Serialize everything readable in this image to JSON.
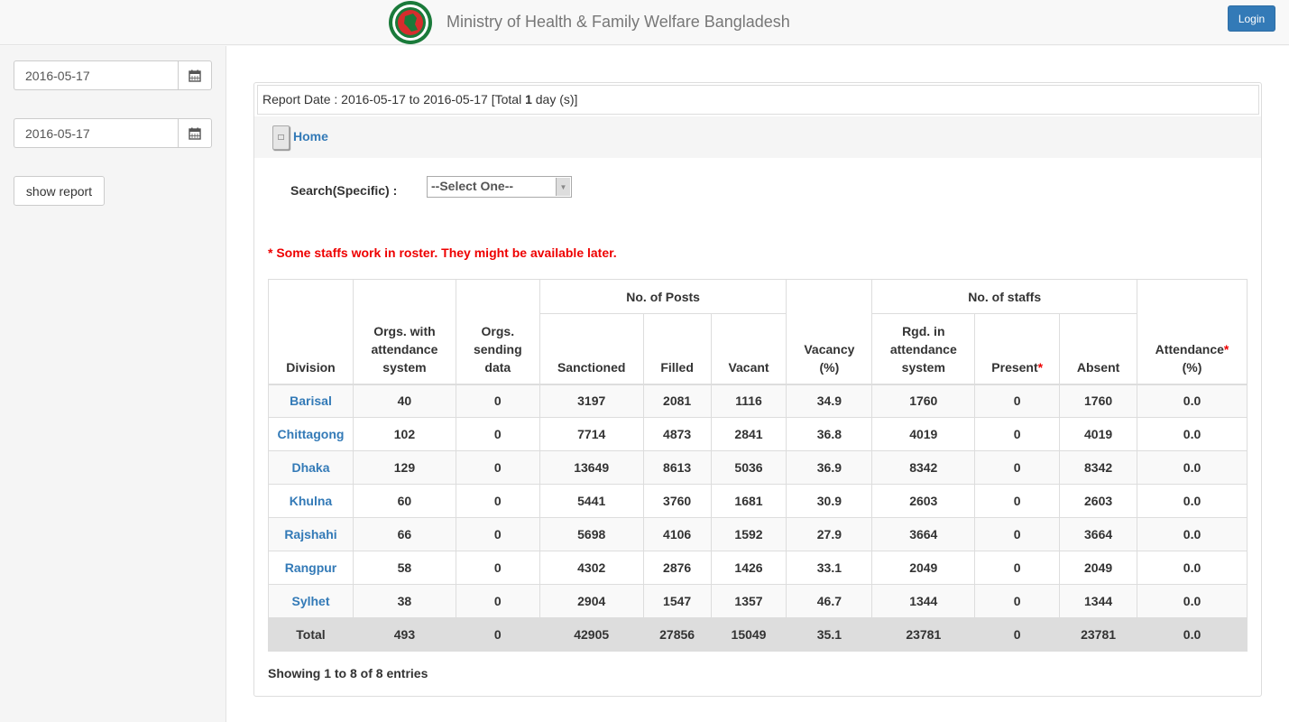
{
  "header": {
    "brand": "Ministry of Health & Family Welfare Bangladesh",
    "login_label": "Login",
    "colors": {
      "primary": "#337ab7",
      "logo_green": "#1a7a3a",
      "logo_red": "#d62d2d"
    }
  },
  "sidebar": {
    "from_date": "2016-05-17",
    "to_date": "2016-05-17",
    "show_report_label": "show report"
  },
  "report": {
    "date_prefix": "Report Date : 2016-05-17 to 2016-05-17 [Total ",
    "total_days": "1",
    "date_suffix": " day (s)]",
    "home_label": "Home",
    "search_label": "Search(Specific) :",
    "select_value": "--Select One--",
    "note": "* Some staffs work in roster. They might be available later.",
    "showing": "Showing 1 to 8 of 8 entries"
  },
  "table": {
    "headers": {
      "division": "Division",
      "orgs_attendance": "Orgs. with attendance system",
      "orgs_sending": "Orgs. sending data",
      "posts_group": "No. of Posts",
      "sanctioned": "Sanctioned",
      "filled": "Filled",
      "vacant": "Vacant",
      "vacancy": "Vacancy (%)",
      "staffs_group": "No. of staffs",
      "rgd": "Rgd. in attendance system",
      "present": "Present",
      "absent": "Absent",
      "attendance": "Attendance",
      "attendance_pct": "(%)",
      "req_mark": "*"
    },
    "rows": [
      [
        "Barisal",
        "40",
        "0",
        "3197",
        "2081",
        "1116",
        "34.9",
        "1760",
        "0",
        "1760",
        "0.0"
      ],
      [
        "Chittagong",
        "102",
        "0",
        "7714",
        "4873",
        "2841",
        "36.8",
        "4019",
        "0",
        "4019",
        "0.0"
      ],
      [
        "Dhaka",
        "129",
        "0",
        "13649",
        "8613",
        "5036",
        "36.9",
        "8342",
        "0",
        "8342",
        "0.0"
      ],
      [
        "Khulna",
        "60",
        "0",
        "5441",
        "3760",
        "1681",
        "30.9",
        "2603",
        "0",
        "2603",
        "0.0"
      ],
      [
        "Rajshahi",
        "66",
        "0",
        "5698",
        "4106",
        "1592",
        "27.9",
        "3664",
        "0",
        "3664",
        "0.0"
      ],
      [
        "Rangpur",
        "58",
        "0",
        "4302",
        "2876",
        "1426",
        "33.1",
        "2049",
        "0",
        "2049",
        "0.0"
      ],
      [
        "Sylhet",
        "38",
        "0",
        "2904",
        "1547",
        "1357",
        "46.7",
        "1344",
        "0",
        "1344",
        "0.0"
      ]
    ],
    "total": [
      "Total",
      "493",
      "0",
      "42905",
      "27856",
      "15049",
      "35.1",
      "23781",
      "0",
      "23781",
      "0.0"
    ]
  }
}
